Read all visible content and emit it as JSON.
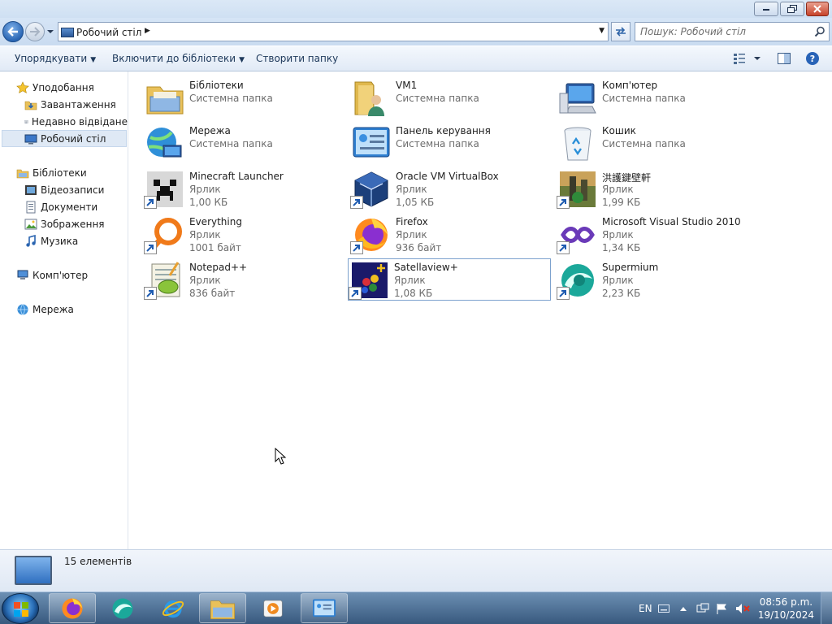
{
  "window": {
    "caption_buttons": [
      "minimize-icon",
      "restore-icon",
      "close-icon"
    ]
  },
  "address_bar": {
    "path": "Робочий стіл",
    "search_placeholder": "Пошук: Робочий стіл"
  },
  "toolbar": {
    "organize": "Упорядкувати",
    "include_in_library": "Включити до бібліотеки",
    "new_folder": "Створити папку"
  },
  "sidebar": {
    "favorites": {
      "label": "Уподобання",
      "items": [
        {
          "label": "Завантаження",
          "icon": "downloads-icon"
        },
        {
          "label": "Недавно відвідане",
          "icon": "recent-places-icon"
        },
        {
          "label": "Робочий стіл",
          "icon": "desktop-icon",
          "selected": true
        }
      ]
    },
    "libraries": {
      "label": "Бібліотеки",
      "items": [
        {
          "label": "Відеозаписи",
          "icon": "videos-icon"
        },
        {
          "label": "Документи",
          "icon": "documents-icon"
        },
        {
          "label": "Зображення",
          "icon": "pictures-icon"
        },
        {
          "label": "Музика",
          "icon": "music-icon"
        }
      ]
    },
    "computer": {
      "label": "Комп'ютер"
    },
    "network": {
      "label": "Мережа"
    }
  },
  "items": [
    {
      "name": "Бібліотеки",
      "type": "Системна папка",
      "size": "",
      "icon": "libraries-icon"
    },
    {
      "name": "VM1",
      "type": "Системна папка",
      "size": "",
      "icon": "user-folder-icon"
    },
    {
      "name": "Комп'ютер",
      "type": "Системна папка",
      "size": "",
      "icon": "computer-icon"
    },
    {
      "name": "Мережа",
      "type": "Системна папка",
      "size": "",
      "icon": "network-icon"
    },
    {
      "name": "Панель керування",
      "type": "Системна папка",
      "size": "",
      "icon": "control-panel-icon"
    },
    {
      "name": "Кошик",
      "type": "Системна папка",
      "size": "",
      "icon": "recycle-bin-icon"
    },
    {
      "name": "Minecraft Launcher",
      "type": "Ярлик",
      "size": "1,00 КБ",
      "icon": "minecraft-icon"
    },
    {
      "name": "Oracle VM VirtualBox",
      "type": "Ярлик",
      "size": "1,05 КБ",
      "icon": "virtualbox-icon"
    },
    {
      "name": "洪護鍵壁軒",
      "type": "Ярлик",
      "size": "1,99 КБ",
      "icon": "game-icon"
    },
    {
      "name": "Everything",
      "type": "Ярлик",
      "size": "1001 байт",
      "icon": "everything-search-icon"
    },
    {
      "name": "Firefox",
      "type": "Ярлик",
      "size": "936 байт",
      "icon": "firefox-icon"
    },
    {
      "name": "Microsoft Visual Studio 2010",
      "type": "Ярлик",
      "size": "1,34 КБ",
      "icon": "visual-studio-icon"
    },
    {
      "name": "Notepad++",
      "type": "Ярлик",
      "size": "836 байт",
      "icon": "notepadpp-icon"
    },
    {
      "name": "Satellaview+",
      "type": "Ярлик",
      "size": "1,08 КБ",
      "icon": "satellaview-icon",
      "selected": true
    },
    {
      "name": "Supermium",
      "type": "Ярлик",
      "size": "2,23 КБ",
      "icon": "supermium-icon"
    }
  ],
  "status": {
    "count": "15 елементів"
  },
  "taskbar": {
    "apps": [
      "firefox-icon",
      "supermium-icon",
      "internet-explorer-icon",
      "explorer-icon",
      "media-player-icon",
      "control-panel-icon"
    ],
    "language": "EN",
    "time": "08:56 p.m.",
    "date": "19/10/2024"
  }
}
